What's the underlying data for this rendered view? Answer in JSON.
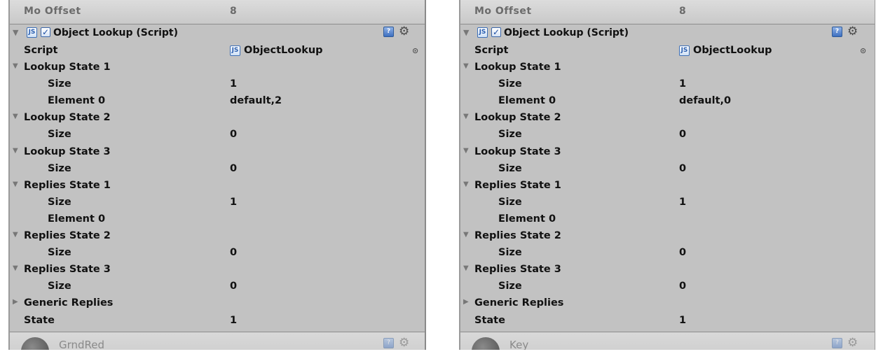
{
  "left": {
    "offset_label": "Mo Offset",
    "offset_value": "8",
    "component_title": "Object Lookup (Script)",
    "js_icon_text": "JS",
    "script_label": "Script",
    "script_value": "ObjectLookup",
    "rows": [
      {
        "type": "group",
        "label": "Lookup State 1",
        "expanded": true,
        "value": ""
      },
      {
        "type": "child",
        "label": "Size",
        "value": "1"
      },
      {
        "type": "child",
        "label": "Element 0",
        "value": "default,2"
      },
      {
        "type": "group",
        "label": "Lookup State 2",
        "expanded": true,
        "value": ""
      },
      {
        "type": "child",
        "label": "Size",
        "value": "0"
      },
      {
        "type": "group",
        "label": "Lookup State 3",
        "expanded": true,
        "value": ""
      },
      {
        "type": "child",
        "label": "Size",
        "value": "0"
      },
      {
        "type": "group",
        "label": "Replies State 1",
        "expanded": true,
        "value": ""
      },
      {
        "type": "child",
        "label": "Size",
        "value": "1"
      },
      {
        "type": "child",
        "label": "Element 0",
        "value": ""
      },
      {
        "type": "group",
        "label": "Replies State 2",
        "expanded": true,
        "value": ""
      },
      {
        "type": "child",
        "label": "Size",
        "value": "0"
      },
      {
        "type": "group",
        "label": "Replies State 3",
        "expanded": true,
        "value": ""
      },
      {
        "type": "child",
        "label": "Size",
        "value": "0"
      },
      {
        "type": "group",
        "label": "Generic Replies",
        "expanded": false,
        "value": ""
      },
      {
        "type": "field",
        "label": "State",
        "value": "1"
      }
    ],
    "footer_name": "GrndRed"
  },
  "right": {
    "offset_label": "Mo Offset",
    "offset_value": "8",
    "component_title": "Object Lookup (Script)",
    "js_icon_text": "JS",
    "script_label": "Script",
    "script_value": "ObjectLookup",
    "rows": [
      {
        "type": "group",
        "label": "Lookup State 1",
        "expanded": true,
        "value": ""
      },
      {
        "type": "child",
        "label": "Size",
        "value": "1"
      },
      {
        "type": "child",
        "label": "Element 0",
        "value": "default,0"
      },
      {
        "type": "group",
        "label": "Lookup State 2",
        "expanded": true,
        "value": ""
      },
      {
        "type": "child",
        "label": "Size",
        "value": "0"
      },
      {
        "type": "group",
        "label": "Lookup State 3",
        "expanded": true,
        "value": ""
      },
      {
        "type": "child",
        "label": "Size",
        "value": "0"
      },
      {
        "type": "group",
        "label": "Replies State 1",
        "expanded": true,
        "value": ""
      },
      {
        "type": "child",
        "label": "Size",
        "value": "1"
      },
      {
        "type": "child",
        "label": "Element 0",
        "value": ""
      },
      {
        "type": "group",
        "label": "Replies State 2",
        "expanded": true,
        "value": ""
      },
      {
        "type": "child",
        "label": "Size",
        "value": "0"
      },
      {
        "type": "group",
        "label": "Replies State 3",
        "expanded": true,
        "value": ""
      },
      {
        "type": "child",
        "label": "Size",
        "value": "0"
      },
      {
        "type": "group",
        "label": "Generic Replies",
        "expanded": false,
        "value": ""
      },
      {
        "type": "field",
        "label": "State",
        "value": "1"
      }
    ],
    "footer_name": "Key"
  },
  "icons": {
    "fold": "triangle-down-icon",
    "collapsed": "triangle-right-icon",
    "help": "help-book-icon",
    "settings": "gear-icon",
    "picker": "object-picker-icon"
  }
}
